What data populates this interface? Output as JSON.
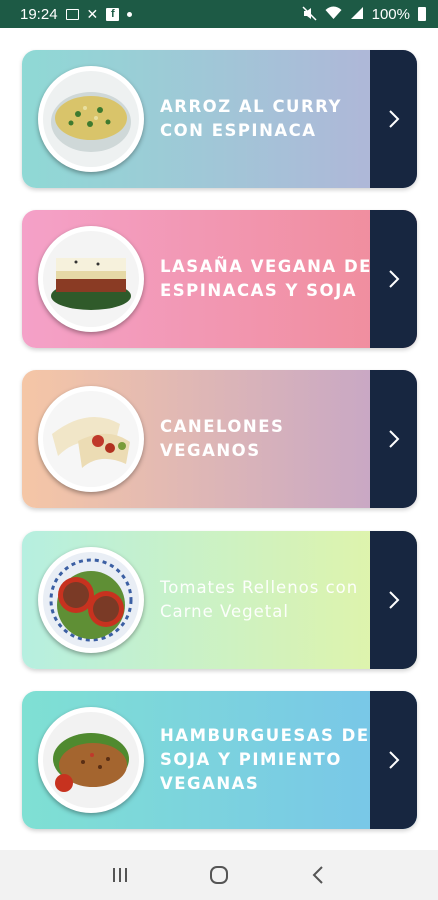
{
  "status_bar": {
    "time": "19:24",
    "battery": "100%"
  },
  "recipes": [
    {
      "title": "ARROZ AL CURRY CON ESPINACA",
      "gradient": [
        "#8fd9d5",
        "#b3b3d9"
      ],
      "style": "bold"
    },
    {
      "title": "LASAÑA VEGANA DE ESPINACAS Y SOJA",
      "gradient": [
        "#f4a1c8",
        "#f08c9a"
      ],
      "style": "bold"
    },
    {
      "title": "CANELONES VEGANOS",
      "gradient": [
        "#f5c6a6",
        "#c3a4c8"
      ],
      "style": "bold"
    },
    {
      "title": "Tomates Rellenos con Carne Vegetal",
      "gradient": [
        "#b6efe0",
        "#e3f4a6"
      ],
      "style": "light"
    },
    {
      "title": "HAMBURGUESAS DE SOJA Y PIMIENTO VEGANAS",
      "gradient": [
        "#7fe0d3",
        "#78c4ea"
      ],
      "style": "bold"
    }
  ],
  "colors": {
    "status_bar": "#1d5a45",
    "arrow_panel": "#172640",
    "nav_bar": "#f2f2f2"
  },
  "icons": {
    "card_arrow": "chevron-right-icon",
    "nav_recent": "recent-apps-icon",
    "nav_home": "home-icon",
    "nav_back": "back-icon"
  }
}
